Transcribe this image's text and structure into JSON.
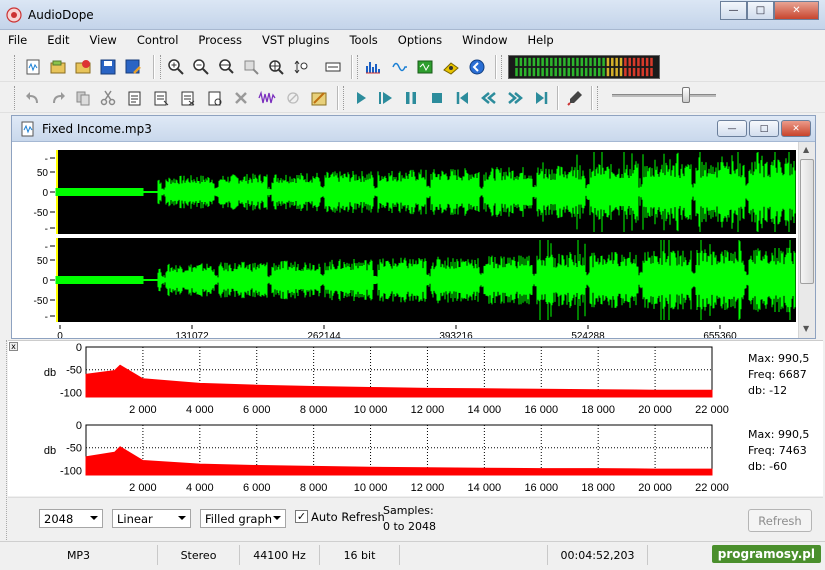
{
  "app": {
    "title": "AudioDope"
  },
  "window_controls": {
    "minimize": "—",
    "maximize": "□",
    "close": "✕"
  },
  "menu": [
    "File",
    "Edit",
    "View",
    "Control",
    "Process",
    "VST plugins",
    "Tools",
    "Options",
    "Window",
    "Help"
  ],
  "toolbar1": {
    "icons": [
      "new-file-icon",
      "open-file-icon",
      "close-file-icon",
      "save-icon",
      "save-as-icon",
      "zoom-in-icon",
      "zoom-out-icon",
      "zoom-horizontal-icon",
      "zoom-select-icon",
      "zoom-all-icon",
      "zoom-vertical-icon",
      "fit-icon",
      "spectrum-icon",
      "wave-icon",
      "vst-icon",
      "cd-icon",
      "info-icon"
    ]
  },
  "toolbar2": {
    "icons": [
      "undo-icon",
      "redo-icon",
      "copy-icon",
      "cut-icon",
      "paste-icon",
      "paste-new-icon",
      "mix-paste-icon",
      "paste-special-icon",
      "delete-icon",
      "trim-icon",
      "silence-icon",
      "marker-icon",
      "play-icon",
      "play-loop-icon",
      "pause-icon",
      "stop-icon",
      "go-start-icon",
      "rewind-icon",
      "fast-forward-icon",
      "go-end-icon",
      "record-icon"
    ],
    "volume_level": 0.73
  },
  "meter": {
    "segments": 32,
    "green_count": 21,
    "yellow_count": 4,
    "red_count": 7
  },
  "document": {
    "title": "Fixed Income.mp3",
    "channels": [
      {
        "ticks": [
          "-",
          "50",
          "0",
          "-50",
          "-"
        ]
      },
      {
        "ticks": [
          "-",
          "50",
          "0",
          "-50",
          "-"
        ]
      }
    ],
    "timeline": [
      "0",
      "131072",
      "262144",
      "393216",
      "524288",
      "655360"
    ]
  },
  "analyzer": {
    "y_label": "db",
    "y_ticks": [
      "0",
      "-50",
      "-100"
    ],
    "x_ticks": [
      "2 000",
      "4 000",
      "6 000",
      "8 000",
      "10 000",
      "12 000",
      "14 000",
      "16 000",
      "18 000",
      "20 000",
      "22 000"
    ],
    "channels": [
      {
        "max_label": "Max: 990,5",
        "freq_label": "Freq: 6687",
        "db_label": "db: -12"
      },
      {
        "max_label": "Max: 990,5",
        "freq_label": "Freq: 7463",
        "db_label": "db: -60"
      }
    ]
  },
  "chart_data": [
    {
      "type": "area",
      "x": [
        0,
        1000,
        1200,
        2000,
        4000,
        6000,
        8000,
        10000,
        12000,
        14000,
        16000,
        18000,
        20000,
        22000
      ],
      "y": [
        -60,
        -52,
        -40,
        -70,
        -80,
        -84,
        -87,
        -89,
        -91,
        -92,
        -93,
        -94,
        -95,
        -95
      ],
      "xlim": [
        0,
        22000
      ],
      "ylim": [
        -110,
        0
      ],
      "color": "#ff0000"
    },
    {
      "type": "area",
      "x": [
        0,
        1000,
        1200,
        2000,
        4000,
        6000,
        8000,
        10000,
        12000,
        14000,
        16000,
        18000,
        20000,
        22000
      ],
      "y": [
        -70,
        -60,
        -48,
        -78,
        -86,
        -89,
        -91,
        -93,
        -94,
        -95,
        -96,
        -96,
        -97,
        -97
      ],
      "xlim": [
        0,
        22000
      ],
      "ylim": [
        -110,
        0
      ],
      "color": "#ff0000"
    }
  ],
  "controls": {
    "fft_size": "2048",
    "scale": "Linear",
    "graph_mode": "Filled graph",
    "auto_refresh_label": "Auto Refresh",
    "auto_refresh_checked": true,
    "samples_label": "Samples:",
    "samples_range": "0 to 2048",
    "refresh_label": "Refresh"
  },
  "status": {
    "format": "MP3",
    "channels": "Stereo",
    "rate": "44100 Hz",
    "bits": "16 bit",
    "duration": "00:04:52,203",
    "badge": "programosy.pl"
  },
  "colors": {
    "wave": "#00ff00",
    "wave_bg": "#000000",
    "spectrum": "#ff0000",
    "selection": "#ffff00"
  }
}
